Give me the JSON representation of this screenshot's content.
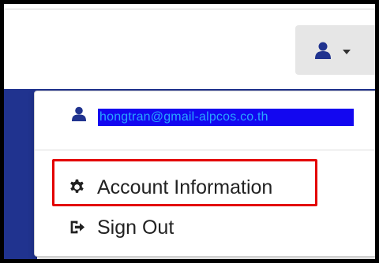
{
  "navbar": {
    "user_menu_icon": "user-icon",
    "caret_icon": "caret-down-icon"
  },
  "dropdown": {
    "email_text": "hongtran@gmail-alpcos.co.th",
    "account_information_label": "Account Information",
    "sign_out_label": "Sign Out",
    "account_information_icon": "gear-icon",
    "sign_out_icon": "sign-out-icon",
    "user_icon": "user-icon"
  },
  "colors": {
    "frame": "#000000",
    "navbar_toggle": "#e6e6e6",
    "icon": "#20338f",
    "selection": "#1307f0",
    "highlight": "#e30000",
    "text": "#222222"
  }
}
